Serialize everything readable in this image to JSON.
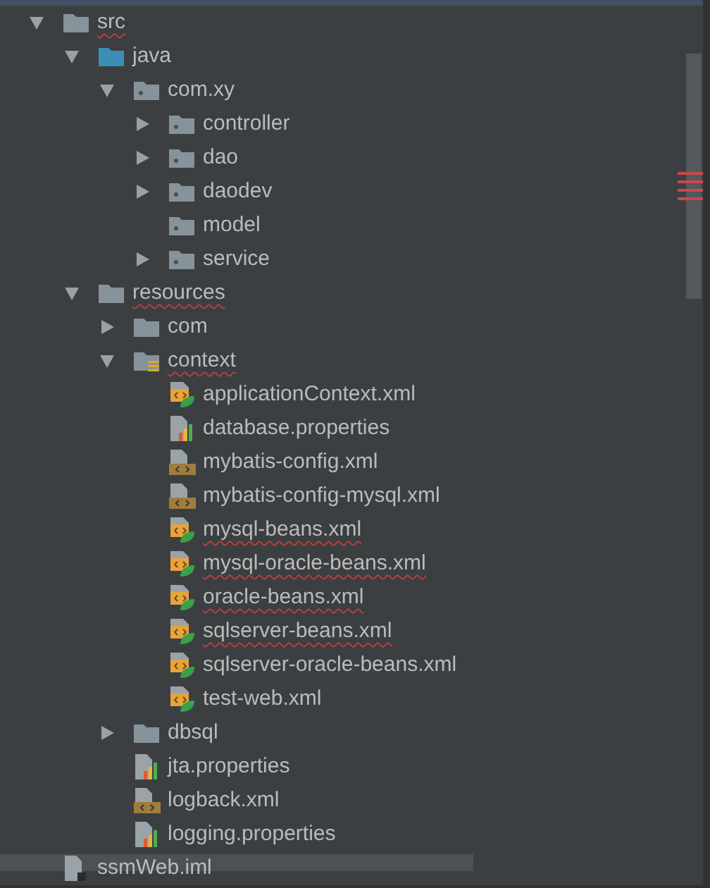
{
  "tree": [
    {
      "name": "src",
      "kind": "folder",
      "expanded": true,
      "spelling_error": true,
      "children": [
        {
          "name": "java",
          "kind": "source-root",
          "expanded": true,
          "spelling_error": false,
          "children": [
            {
              "name": "com.xy",
              "kind": "package",
              "expanded": true,
              "spelling_error": false,
              "children": [
                {
                  "name": "controller",
                  "kind": "package",
                  "expanded": false,
                  "spelling_error": false
                },
                {
                  "name": "dao",
                  "kind": "package",
                  "expanded": false,
                  "spelling_error": false
                },
                {
                  "name": "daodev",
                  "kind": "package",
                  "expanded": false,
                  "spelling_error": false
                },
                {
                  "name": "model",
                  "kind": "package",
                  "spelling_error": false
                },
                {
                  "name": "service",
                  "kind": "package",
                  "expanded": false,
                  "spelling_error": false
                }
              ]
            }
          ]
        },
        {
          "name": "resources",
          "kind": "folder",
          "expanded": true,
          "spelling_error": true,
          "children": [
            {
              "name": "com",
              "kind": "folder",
              "expanded": false,
              "spelling_error": false
            },
            {
              "name": "context",
              "kind": "resource-folder",
              "expanded": true,
              "spelling_error": true,
              "children": [
                {
                  "name": "applicationContext.xml",
                  "kind": "spring-xml",
                  "spelling_error": false
                },
                {
                  "name": "database.properties",
                  "kind": "properties",
                  "spelling_error": false
                },
                {
                  "name": "mybatis-config.xml",
                  "kind": "xml",
                  "spelling_error": false
                },
                {
                  "name": "mybatis-config-mysql.xml",
                  "kind": "xml",
                  "spelling_error": false
                },
                {
                  "name": "mysql-beans.xml",
                  "kind": "spring-xml",
                  "spelling_error": true
                },
                {
                  "name": "mysql-oracle-beans.xml",
                  "kind": "spring-xml",
                  "spelling_error": true
                },
                {
                  "name": "oracle-beans.xml",
                  "kind": "spring-xml",
                  "spelling_error": true
                },
                {
                  "name": "sqlserver-beans.xml",
                  "kind": "spring-xml",
                  "spelling_error": true
                },
                {
                  "name": "sqlserver-oracle-beans.xml",
                  "kind": "spring-xml",
                  "spelling_error": false
                },
                {
                  "name": "test-web.xml",
                  "kind": "spring-xml",
                  "spelling_error": false
                }
              ]
            },
            {
              "name": "dbsql",
              "kind": "folder",
              "expanded": false,
              "spelling_error": false
            },
            {
              "name": "jta.properties",
              "kind": "properties",
              "spelling_error": false
            },
            {
              "name": "logback.xml",
              "kind": "xml",
              "spelling_error": false
            },
            {
              "name": "logging.properties",
              "kind": "properties",
              "spelling_error": false
            }
          ]
        }
      ]
    },
    {
      "name": "ssmWeb.iml",
      "kind": "iml",
      "spelling_error": false
    }
  ]
}
